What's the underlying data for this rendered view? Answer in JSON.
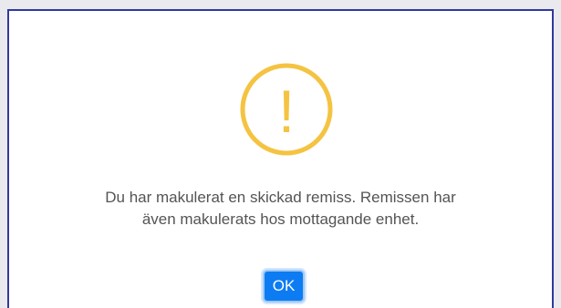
{
  "dialog": {
    "icon": "warning-exclamation-icon",
    "icon_glyph": "!",
    "message_line1": "Du har makulerat en skickad remiss. Remissen har",
    "message_line2": "även makulerats hos mottagande enhet.",
    "ok_label": "OK"
  },
  "colors": {
    "warning": "#f5c342",
    "button_bg": "#0d7cf2",
    "text": "#545454",
    "frame_border": "#2f3a9e"
  }
}
